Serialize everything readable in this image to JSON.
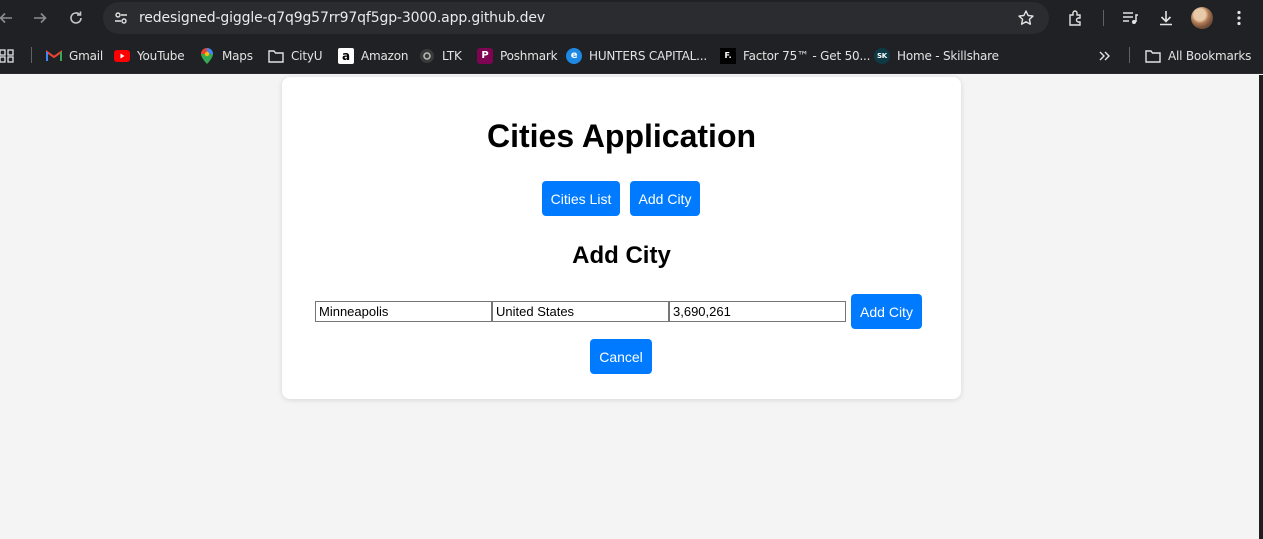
{
  "browser": {
    "url": "redesigned-giggle-q7q9g57rr97qf5gp-3000.app.github.dev",
    "bookmarks": [
      {
        "label": "Gmail",
        "icon": "gmail-icon"
      },
      {
        "label": "YouTube",
        "icon": "youtube-icon"
      },
      {
        "label": "Maps",
        "icon": "maps-icon"
      },
      {
        "label": "CityU",
        "icon": "folder-icon"
      },
      {
        "label": "Amazon",
        "icon": "amazon-icon"
      },
      {
        "label": "LTK",
        "icon": "ltk-icon"
      },
      {
        "label": "Poshmark",
        "icon": "poshmark-icon"
      },
      {
        "label": "HUNTERS CAPITAL...",
        "icon": "hunters-capital-icon"
      },
      {
        "label": "Factor 75™ - Get 50...",
        "icon": "factor75-icon"
      },
      {
        "label": "Home - Skillshare",
        "icon": "skillshare-icon"
      }
    ],
    "all_bookmarks": "All Bookmarks"
  },
  "app": {
    "title": "Cities Application",
    "nav": {
      "cities_list": "Cities List",
      "add_city": "Add City"
    },
    "form": {
      "heading": "Add City",
      "city_value": "Minneapolis",
      "country_value": "United States",
      "population_value": "3,690,261",
      "submit_label": "Add City",
      "cancel_label": "Cancel"
    }
  },
  "colors": {
    "accent": "#007bff",
    "chrome_bg": "#202124",
    "page_bg": "#f4f4f4"
  }
}
